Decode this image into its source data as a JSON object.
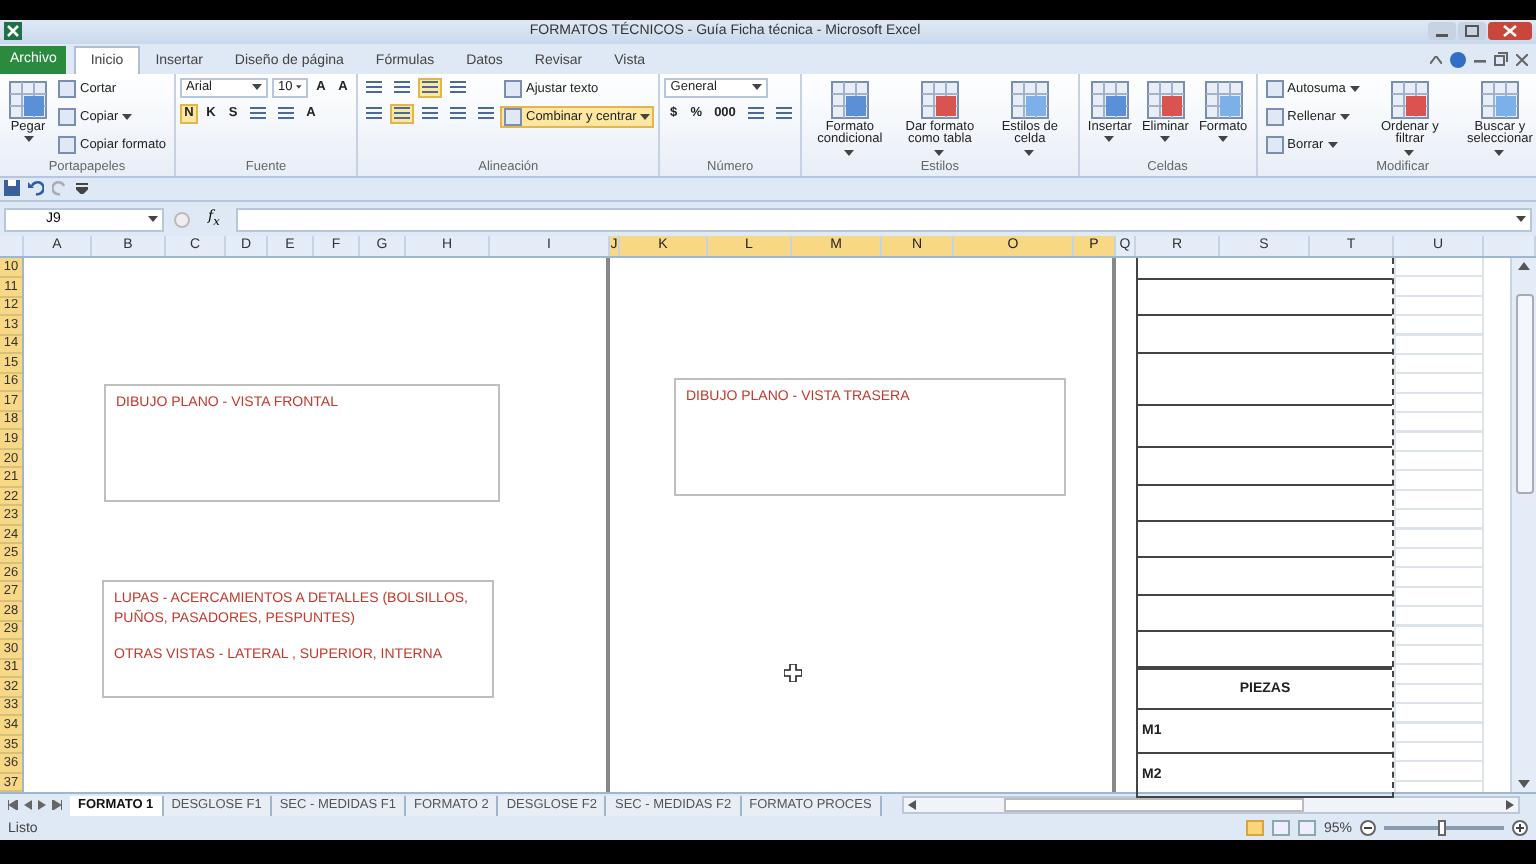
{
  "window": {
    "title": "FORMATOS TÉCNICOS - Guía Ficha técnica - Microsoft Excel"
  },
  "file_tab": "Archivo",
  "ribbon_tabs": [
    {
      "label": "Inicio",
      "selected": true
    },
    {
      "label": "Insertar",
      "selected": false
    },
    {
      "label": "Diseño de página",
      "selected": false
    },
    {
      "label": "Fórmulas",
      "selected": false
    },
    {
      "label": "Datos",
      "selected": false
    },
    {
      "label": "Revisar",
      "selected": false
    },
    {
      "label": "Vista",
      "selected": false
    }
  ],
  "ribbon_groups": [
    {
      "label": "Portapapeles",
      "columns": [
        {
          "kind": "large",
          "label": "Pegar",
          "menu": true
        },
        {
          "kind": "stack",
          "lines": [
            [
              {
                "kind": "small",
                "label": "Cortar",
                "menu": false
              }
            ],
            [
              {
                "kind": "small",
                "label": "Copiar",
                "menu": true
              }
            ],
            [
              {
                "kind": "small",
                "label": "Copiar formato",
                "menu": false
              }
            ]
          ]
        }
      ]
    },
    {
      "label": "Fuente",
      "columns": [
        {
          "kind": "stack",
          "lines": [
            [
              {
                "kind": "combo",
                "value": "Arial"
              },
              {
                "kind": "combo",
                "value": "10"
              },
              {
                "kind": "tool",
                "text": "A",
                "on": false
              },
              {
                "kind": "tool",
                "text": "A",
                "on": false
              }
            ],
            [
              {
                "kind": "tool",
                "text": "N",
                "on": true
              },
              {
                "kind": "tool",
                "text": "K",
                "on": false
              },
              {
                "kind": "tool",
                "text": "S",
                "on": false
              },
              {
                "kind": "tool",
                "on": false
              },
              {
                "kind": "tool",
                "on": false
              },
              {
                "kind": "tool",
                "text": "A",
                "on": false
              }
            ]
          ]
        }
      ]
    },
    {
      "label": "Alineación",
      "columns": [
        {
          "kind": "stack",
          "lines": [
            [
              {
                "kind": "tool",
                "on": false
              },
              {
                "kind": "tool",
                "on": false
              },
              {
                "kind": "tool",
                "on": true
              },
              {
                "kind": "tool",
                "on": false
              }
            ],
            [
              {
                "kind": "tool",
                "on": false
              },
              {
                "kind": "tool",
                "on": true
              },
              {
                "kind": "tool",
                "on": false
              },
              {
                "kind": "tool",
                "on": false
              },
              {
                "kind": "tool",
                "on": false
              }
            ]
          ]
        },
        {
          "kind": "stack",
          "lines": [
            [
              {
                "kind": "small",
                "label": "Ajustar texto",
                "menu": false
              }
            ],
            [
              {
                "kind": "small",
                "label": "Combinar y centrar",
                "menu": true,
                "on": true
              }
            ]
          ]
        }
      ]
    },
    {
      "label": "Número",
      "columns": [
        {
          "kind": "stack",
          "lines": [
            [
              {
                "kind": "combo",
                "value": "General"
              }
            ],
            [
              {
                "kind": "tool",
                "text": "$",
                "on": false
              },
              {
                "kind": "tool",
                "text": "%",
                "on": false
              },
              {
                "kind": "tool",
                "text": "000",
                "on": false
              },
              {
                "kind": "tool",
                "on": false
              },
              {
                "kind": "tool",
                "on": false
              }
            ]
          ]
        }
      ]
    },
    {
      "label": "Estilos",
      "columns": [
        {
          "kind": "large",
          "label": "Formato condicional",
          "menu": true
        },
        {
          "kind": "large",
          "label": "Dar formato como tabla",
          "menu": true
        },
        {
          "kind": "large",
          "label": "Estilos de celda",
          "menu": true
        }
      ]
    },
    {
      "label": "Celdas",
      "columns": [
        {
          "kind": "large",
          "label": "Insertar",
          "menu": true
        },
        {
          "kind": "large",
          "label": "Eliminar",
          "menu": true
        },
        {
          "kind": "large",
          "label": "Formato",
          "menu": true
        }
      ]
    },
    {
      "label": "Modificar",
      "columns": [
        {
          "kind": "stack",
          "lines": [
            [
              {
                "kind": "small",
                "label": "Autosuma",
                "menu": true
              }
            ],
            [
              {
                "kind": "small",
                "label": "Rellenar",
                "menu": true
              }
            ],
            [
              {
                "kind": "small",
                "label": "Borrar",
                "menu": true
              }
            ]
          ]
        },
        {
          "kind": "large",
          "label": "Ordenar y filtrar",
          "menu": true
        },
        {
          "kind": "large",
          "label": "Buscar y seleccionar",
          "menu": true
        }
      ]
    }
  ],
  "formula_bar": {
    "name_box": "J9",
    "fx": "f$_{x}$"
  },
  "columns": [
    {
      "label": "A",
      "selected": false
    },
    {
      "label": "B",
      "selected": false
    },
    {
      "label": "C",
      "selected": false
    },
    {
      "label": "D",
      "selected": false
    },
    {
      "label": "E",
      "selected": false
    },
    {
      "label": "F",
      "selected": false
    },
    {
      "label": "G",
      "selected": false
    },
    {
      "label": "H",
      "selected": false
    },
    {
      "label": "I",
      "selected": false
    },
    {
      "label": "J",
      "selected": true
    },
    {
      "label": "K",
      "selected": true
    },
    {
      "label": "L",
      "selected": true
    },
    {
      "label": "M",
      "selected": true
    },
    {
      "label": "N",
      "selected": true
    },
    {
      "label": "O",
      "selected": true
    },
    {
      "label": "P",
      "selected": true
    },
    {
      "label": "Q",
      "selected": false
    },
    {
      "label": "R",
      "selected": false
    },
    {
      "label": "S",
      "selected": false
    },
    {
      "label": "T",
      "selected": false
    },
    {
      "label": "U",
      "selected": false
    }
  ],
  "rows": [
    {
      "label": "10",
      "selected": true
    },
    {
      "label": "11",
      "selected": true
    },
    {
      "label": "12",
      "selected": true
    },
    {
      "label": "13",
      "selected": true
    },
    {
      "label": "14",
      "selected": true
    },
    {
      "label": "15",
      "selected": true
    },
    {
      "label": "16",
      "selected": true
    },
    {
      "label": "17",
      "selected": true
    },
    {
      "label": "18",
      "selected": true
    },
    {
      "label": "19",
      "selected": true
    },
    {
      "label": "20",
      "selected": true
    },
    {
      "label": "21",
      "selected": true
    },
    {
      "label": "22",
      "selected": true
    },
    {
      "label": "23",
      "selected": true
    },
    {
      "label": "24",
      "selected": true
    },
    {
      "label": "25",
      "selected": true
    },
    {
      "label": "26",
      "selected": true
    },
    {
      "label": "27",
      "selected": true
    },
    {
      "label": "28",
      "selected": true
    },
    {
      "label": "29",
      "selected": true
    },
    {
      "label": "30",
      "selected": true
    },
    {
      "label": "31",
      "selected": true
    },
    {
      "label": "32",
      "selected": true
    },
    {
      "label": "33",
      "selected": true
    },
    {
      "label": "34",
      "selected": true
    },
    {
      "label": "35",
      "selected": true
    },
    {
      "label": "36",
      "selected": true
    },
    {
      "label": "37",
      "selected": true
    }
  ],
  "text_boxes": [
    {
      "paragraphs": [
        "DIBUJO PLANO - VISTA FRONTAL"
      ]
    },
    {
      "paragraphs": [
        "LUPAS - ACERCAMIENTOS A DETALLES (BOLSILLOS, PUÑOS, PASADORES, PESPUNTES)",
        "OTRAS VISTAS - LATERAL , SUPERIOR, INTERNA"
      ]
    },
    {
      "paragraphs": [
        "DIBUJO PLANO - VISTA TRASERA"
      ]
    }
  ],
  "table_rows": [
    {
      "kind": "blank"
    },
    {
      "kind": "blank"
    },
    {
      "kind": "blank"
    },
    {
      "kind": "blank"
    },
    {
      "kind": "blank"
    },
    {
      "kind": "blank"
    },
    {
      "kind": "blank"
    },
    {
      "kind": "blank"
    },
    {
      "kind": "blank"
    },
    {
      "kind": "blank"
    },
    {
      "kind": "blank"
    },
    {
      "kind": "header",
      "text": "PIEZAS"
    },
    {
      "kind": "item",
      "text": "M1"
    },
    {
      "kind": "item",
      "text": "M2"
    }
  ],
  "sheet_tabs": [
    {
      "label": "FORMATO 1",
      "selected": true
    },
    {
      "label": "DESGLOSE F1",
      "selected": false
    },
    {
      "label": "SEC - MEDIDAS F1",
      "selected": false
    },
    {
      "label": "FORMATO 2",
      "selected": false
    },
    {
      "label": "DESGLOSE F2",
      "selected": false
    },
    {
      "label": "SEC - MEDIDAS F2",
      "selected": false
    },
    {
      "label": "FORMATO PROCES",
      "selected": false
    }
  ],
  "status_bar": {
    "status": "Listo",
    "views": [
      {
        "selected": true
      },
      {
        "selected": false
      },
      {
        "selected": false
      }
    ],
    "zoom": "95%",
    "zoom_slider": {
      "level": 0.48
    }
  }
}
